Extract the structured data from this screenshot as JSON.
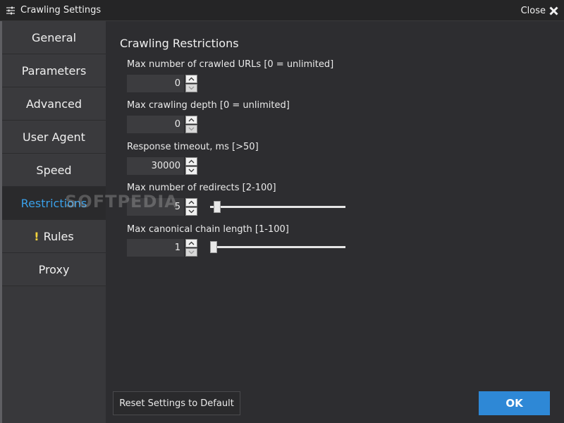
{
  "window": {
    "title": "Crawling Settings",
    "close_label": "Close"
  },
  "sidebar": {
    "items": [
      {
        "label": "General"
      },
      {
        "label": "Parameters"
      },
      {
        "label": "Advanced"
      },
      {
        "label": "User Agent"
      },
      {
        "label": "Speed"
      },
      {
        "label": "Restrictions",
        "active": true
      },
      {
        "label": "Rules",
        "warning": "!"
      },
      {
        "label": "Proxy"
      }
    ]
  },
  "content": {
    "section_title": "Crawling Restrictions",
    "fields": {
      "max_urls": {
        "label": "Max number of crawled URLs [0 = unlimited]",
        "value": "0"
      },
      "max_depth": {
        "label": "Max crawling depth [0 = unlimited]",
        "value": "0"
      },
      "timeout": {
        "label": "Response timeout, ms [>50]",
        "value": "30000"
      },
      "redirects": {
        "label": "Max number of redirects [2-100]",
        "value": "5",
        "slider_level": 0.03
      },
      "canonical": {
        "label": "Max canonical chain length [1-100]",
        "value": "1",
        "slider_level": 0.0
      }
    }
  },
  "footer": {
    "reset_label": "Reset Settings to Default",
    "ok_label": "OK"
  },
  "watermark": "SOFTPEDIA",
  "colors": {
    "accent": "#2e88d6",
    "active_nav": "#3aa0e8",
    "warning": "#f2d23c",
    "background": "#2d2d30",
    "sidebar": "#3a3a3d"
  }
}
